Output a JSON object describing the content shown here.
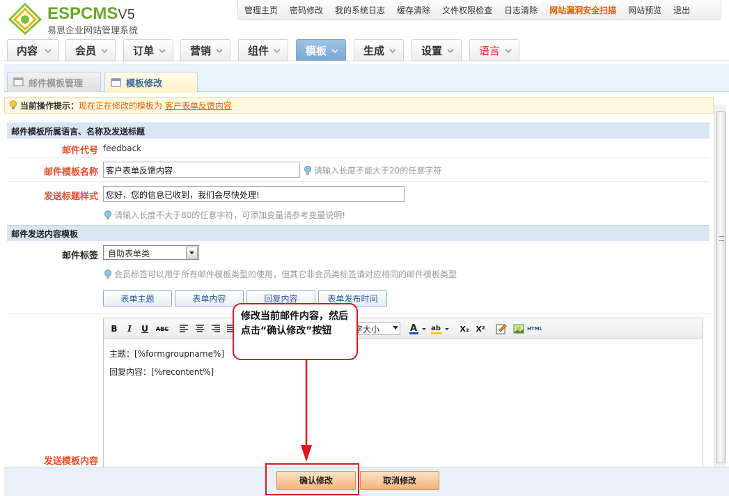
{
  "header": {
    "logo_title": "ESPCMS",
    "logo_version": "V5",
    "logo_subtitle": "易思企业网站管理系统",
    "links": [
      "管理主页",
      "密码修改",
      "我的系统日志",
      "缓存清除",
      "文件权限检查",
      "日志清除",
      "网站漏洞安全扫描",
      "网站预览",
      "退出"
    ]
  },
  "nav": [
    "内容",
    "会员",
    "订单",
    "营销",
    "组件",
    "模板",
    "生成",
    "设置",
    "语言"
  ],
  "tabs": {
    "manage": "邮件模板管理",
    "edit": "模板修改"
  },
  "hint": {
    "label": "当前操作提示：",
    "message": "现在正在修改的模板为",
    "target": "客户表单反馈内容"
  },
  "section1": {
    "title": "邮件模板所属语言、名称及发送标题",
    "code_label": "邮件代号",
    "code_value": "feedback",
    "name_label": "邮件模板名称",
    "name_value": "客户表单反馈内容",
    "name_tip": "请输入长度不能大于20的任意字符",
    "subject_label": "发送标题样式",
    "subject_value": "您好，您的信息已收到，我们会尽快处理!",
    "subject_tip": "请输入长度不大于80的任意字符，可添加变量请参考变量说明!"
  },
  "section2": {
    "title": "邮件发送内容模板",
    "tag_label": "邮件标签",
    "tag_select": "自助表单类",
    "tag_tip": "会员标签可以用于所有邮件模板类型的使用，但其它非会员类标签请对应相同的邮件模板类型",
    "tag_buttons": [
      "表单主题",
      "表单内容",
      "回复内容",
      "表单发布时间"
    ],
    "content_label": "发送模板内容"
  },
  "editor": {
    "bold": "B",
    "italic": "I",
    "underline": "U",
    "strike": "ABC",
    "font_size": "字大小",
    "line1": "主题：[%formgroupname%]",
    "line2": "回复内容：[%recontent%]",
    "html": "HTML",
    "sub": "X₂",
    "sup": "X²"
  },
  "buttons": {
    "confirm": "确认修改",
    "cancel": "取消修改"
  },
  "annotation": {
    "callout": "修改当前邮件内容，然后点击“确认修改”按钮"
  },
  "colors": {
    "accent_orange": "#e06000",
    "nav_active": "#7aa7d4",
    "annotation_red": "#d9141e"
  }
}
